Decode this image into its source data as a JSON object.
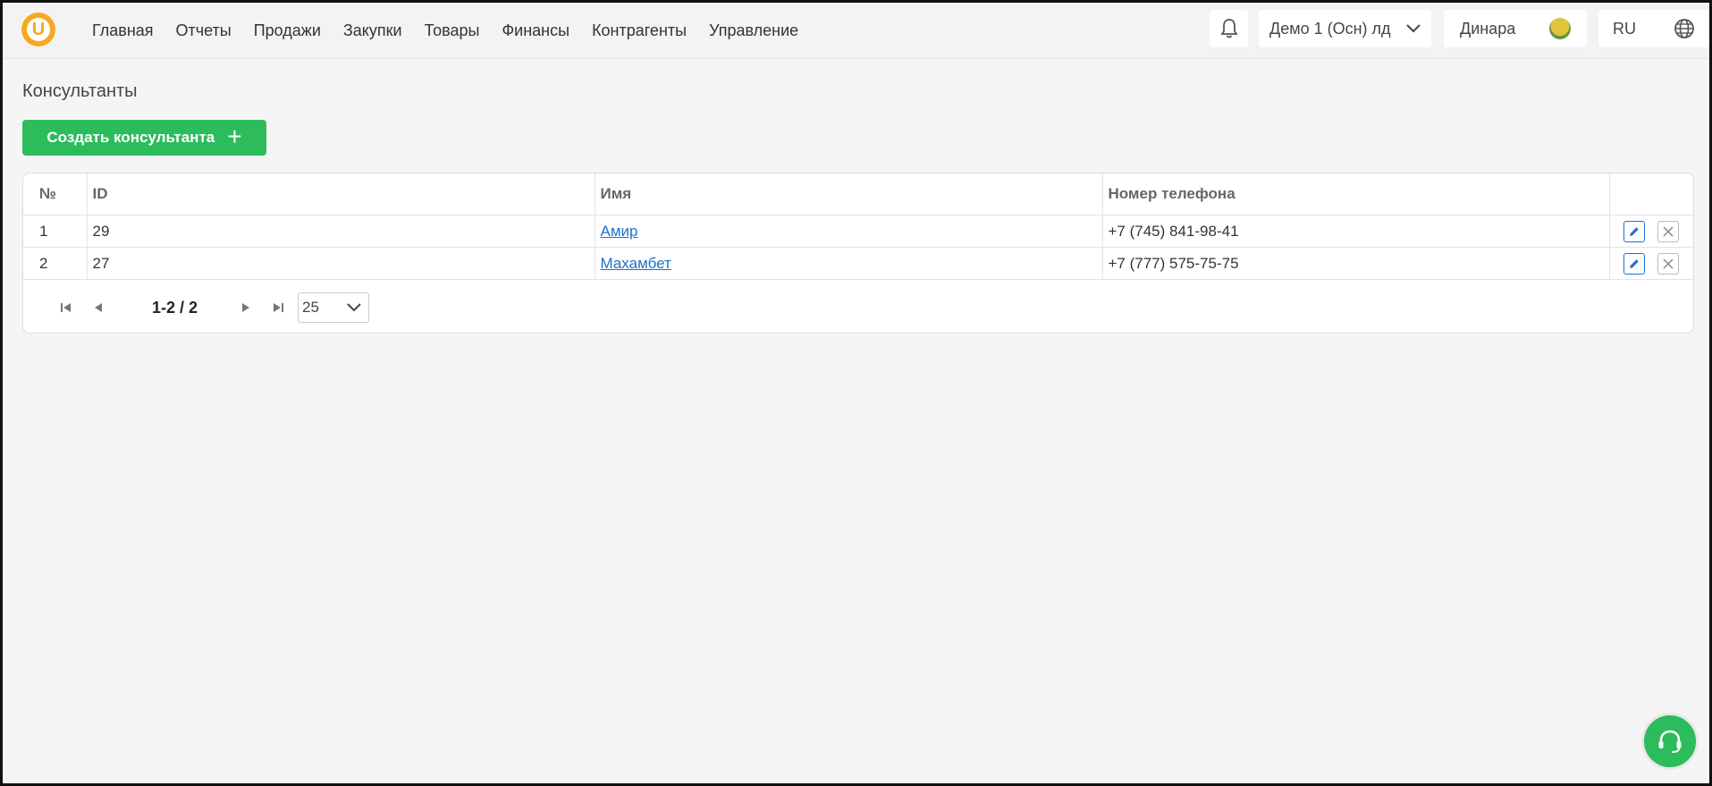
{
  "app": {
    "logo_letter": "U",
    "accent_color": "#f7a823",
    "primary_green": "#2dbc5b",
    "link_color": "#1a73c8"
  },
  "nav": {
    "items": [
      {
        "label": "Главная"
      },
      {
        "label": "Отчеты"
      },
      {
        "label": "Продажи"
      },
      {
        "label": "Закупки"
      },
      {
        "label": "Товары"
      },
      {
        "label": "Финансы"
      },
      {
        "label": "Контрагенты"
      },
      {
        "label": "Управление"
      }
    ]
  },
  "topright": {
    "notifications_icon": "bell-icon",
    "company": "Демо 1 (Осн) лд",
    "user": "Динара",
    "language": "RU",
    "language_icon": "globe-icon"
  },
  "page": {
    "title": "Консультанты",
    "create_button": "Создать консультанта",
    "create_icon": "plus-icon"
  },
  "table": {
    "headers": {
      "num": "№",
      "id": "ID",
      "name": "Имя",
      "phone": "Номер телефона"
    },
    "rows": [
      {
        "num": "1",
        "id": "29",
        "name": "Амир",
        "phone": "+7 (745) 841-98-41"
      },
      {
        "num": "2",
        "id": "27",
        "name": "Махамбет",
        "phone": "+7 (777) 575-75-75"
      }
    ]
  },
  "pagination": {
    "info": "1-2 / 2",
    "page_size": "25"
  },
  "support": {
    "icon": "headset-icon"
  }
}
